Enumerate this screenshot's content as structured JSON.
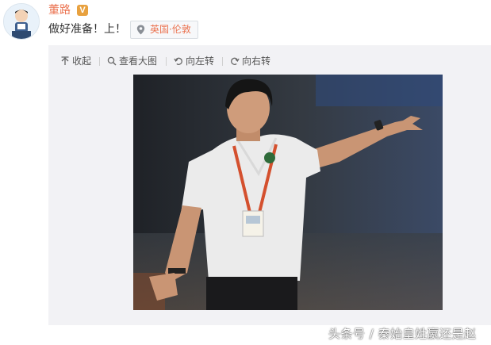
{
  "post": {
    "username": "董路",
    "verified_badge": "V",
    "text": "做好准备！上！",
    "location": "英国·伦敦"
  },
  "toolbar": {
    "collapse": "收起",
    "view_large": "查看大图",
    "rotate_left": "向左转",
    "rotate_right": "向右转"
  },
  "watermark": "头条号 / 秦始皇姓嬴还是赵",
  "colors": {
    "username": "#eb7350",
    "badge": "#e8a13f",
    "panel_bg": "#f2f2f5"
  }
}
